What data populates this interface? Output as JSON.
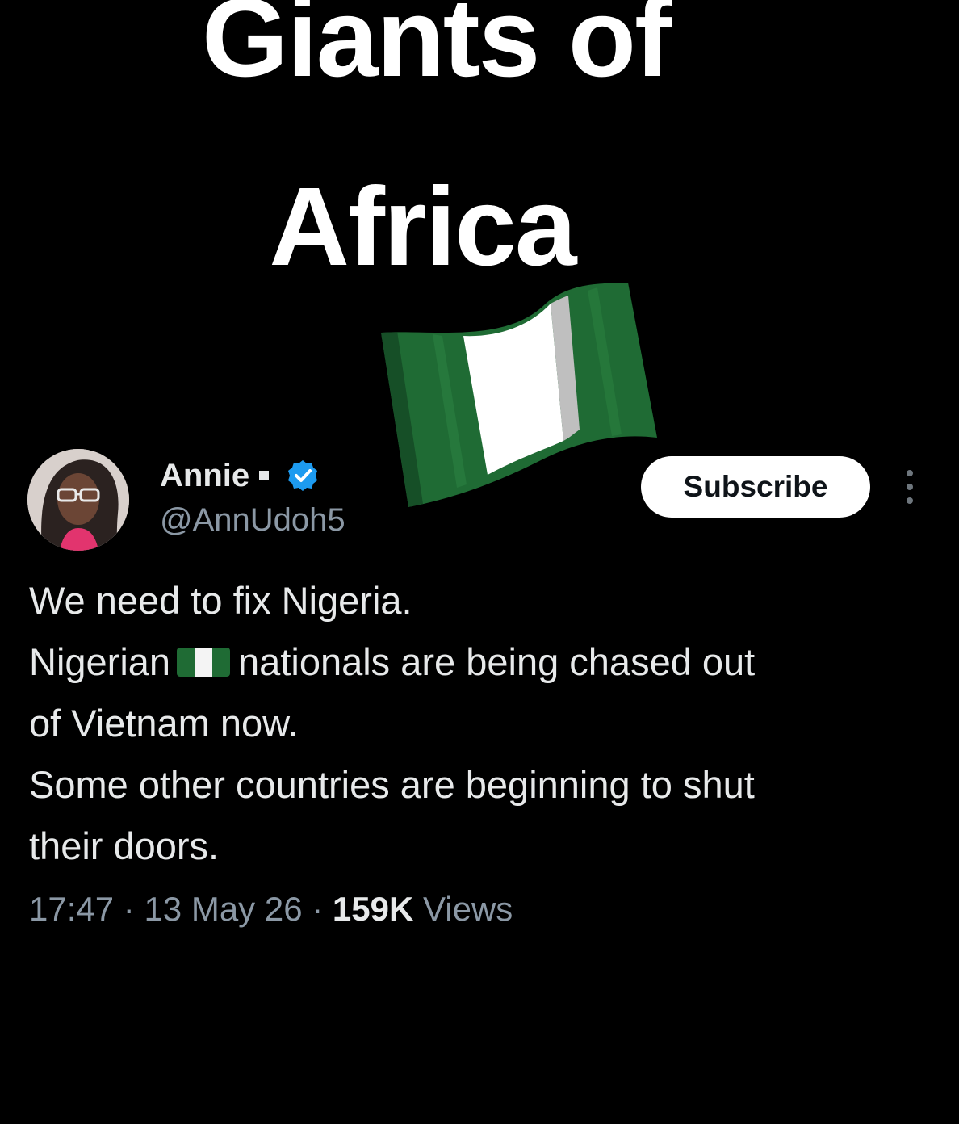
{
  "overlay": {
    "title_line1": "Giants of",
    "title_line2": "Africa",
    "sticker_icon": "nigeria-flag-icon"
  },
  "tweet": {
    "author": {
      "name": "Annie",
      "handle": "@AnnUdoh5",
      "verified": true,
      "verified_color": "#1d9bf0"
    },
    "subscribe_label": "Subscribe",
    "more_icon": "vertical-ellipsis-icon",
    "lines": {
      "line1": "We need to fix Nigeria.",
      "line2_before_flag": "Nigerian",
      "line2_after_flag": "nationals are being chased out",
      "line3": "of Vietnam now.",
      "line4": "Some other countries are beginning to shut",
      "line5": "their doors."
    },
    "inline_icon": "nigeria-flag-emoji",
    "meta": {
      "time": "17:47",
      "date": "13 May 26",
      "views_count": "159K",
      "views_label": "Views",
      "separator": "·"
    }
  },
  "colors": {
    "background": "#000000",
    "text_primary": "#e7e9ea",
    "text_secondary": "#8b98a5",
    "flag_green": "#1f6b34",
    "flag_white": "#ffffff"
  }
}
